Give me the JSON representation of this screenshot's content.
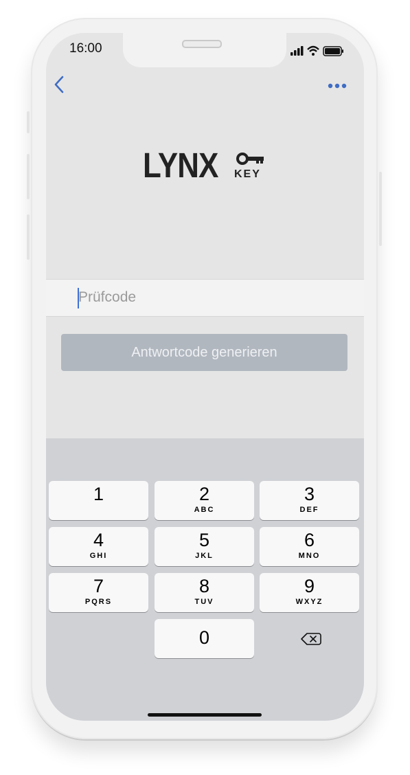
{
  "status_bar": {
    "time": "16:00"
  },
  "nav": {
    "back_icon": "chevron-left-icon",
    "more_icon": "ellipsis-icon",
    "accent": "#3f6dc4"
  },
  "logo": {
    "word": "LYNX",
    "sub": "KEY",
    "icon": "key-icon"
  },
  "verification": {
    "placeholder": "Prüfcode",
    "value": ""
  },
  "generate_button": {
    "label": "Antwortcode generieren"
  },
  "keypad": {
    "keys": [
      {
        "digit": "1",
        "letters": ""
      },
      {
        "digit": "2",
        "letters": "ABC"
      },
      {
        "digit": "3",
        "letters": "DEF"
      },
      {
        "digit": "4",
        "letters": "GHI"
      },
      {
        "digit": "5",
        "letters": "JKL"
      },
      {
        "digit": "6",
        "letters": "MNO"
      },
      {
        "digit": "7",
        "letters": "PQRS"
      },
      {
        "digit": "8",
        "letters": "TUV"
      },
      {
        "digit": "9",
        "letters": "WXYZ"
      },
      {
        "digit": "0",
        "letters": ""
      }
    ],
    "delete_icon": "backspace-icon"
  }
}
